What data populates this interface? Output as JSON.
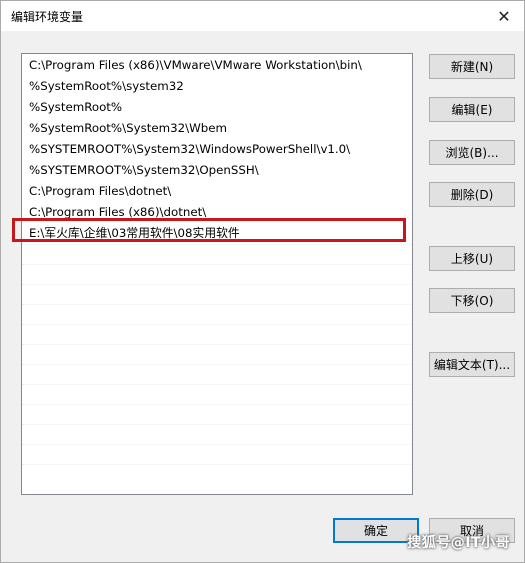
{
  "window": {
    "title": "编辑环境变量",
    "close_glyph": "✕"
  },
  "list": {
    "items": [
      "C:\\Program Files (x86)\\VMware\\VMware Workstation\\bin\\",
      "%SystemRoot%\\system32",
      "%SystemRoot%",
      "%SystemRoot%\\System32\\Wbem",
      "%SYSTEMROOT%\\System32\\WindowsPowerShell\\v1.0\\",
      "%SYSTEMROOT%\\System32\\OpenSSH\\",
      "C:\\Program Files\\dotnet\\",
      "C:\\Program Files (x86)\\dotnet\\",
      "E:\\军火库\\企维\\03常用软件\\08实用软件"
    ]
  },
  "buttons": {
    "new": "新建(N)",
    "edit": "编辑(E)",
    "browse": "浏览(B)...",
    "delete": "删除(D)",
    "move_up": "上移(U)",
    "move_down": "下移(O)",
    "edit_text": "编辑文本(T)...",
    "ok": "确定",
    "cancel": "取消"
  },
  "watermark": "搜狐号@IT小哥",
  "colors": {
    "highlight_border": "#c8171c",
    "default_button_border": "#0078d7"
  },
  "icons": {
    "close": "close-icon"
  }
}
